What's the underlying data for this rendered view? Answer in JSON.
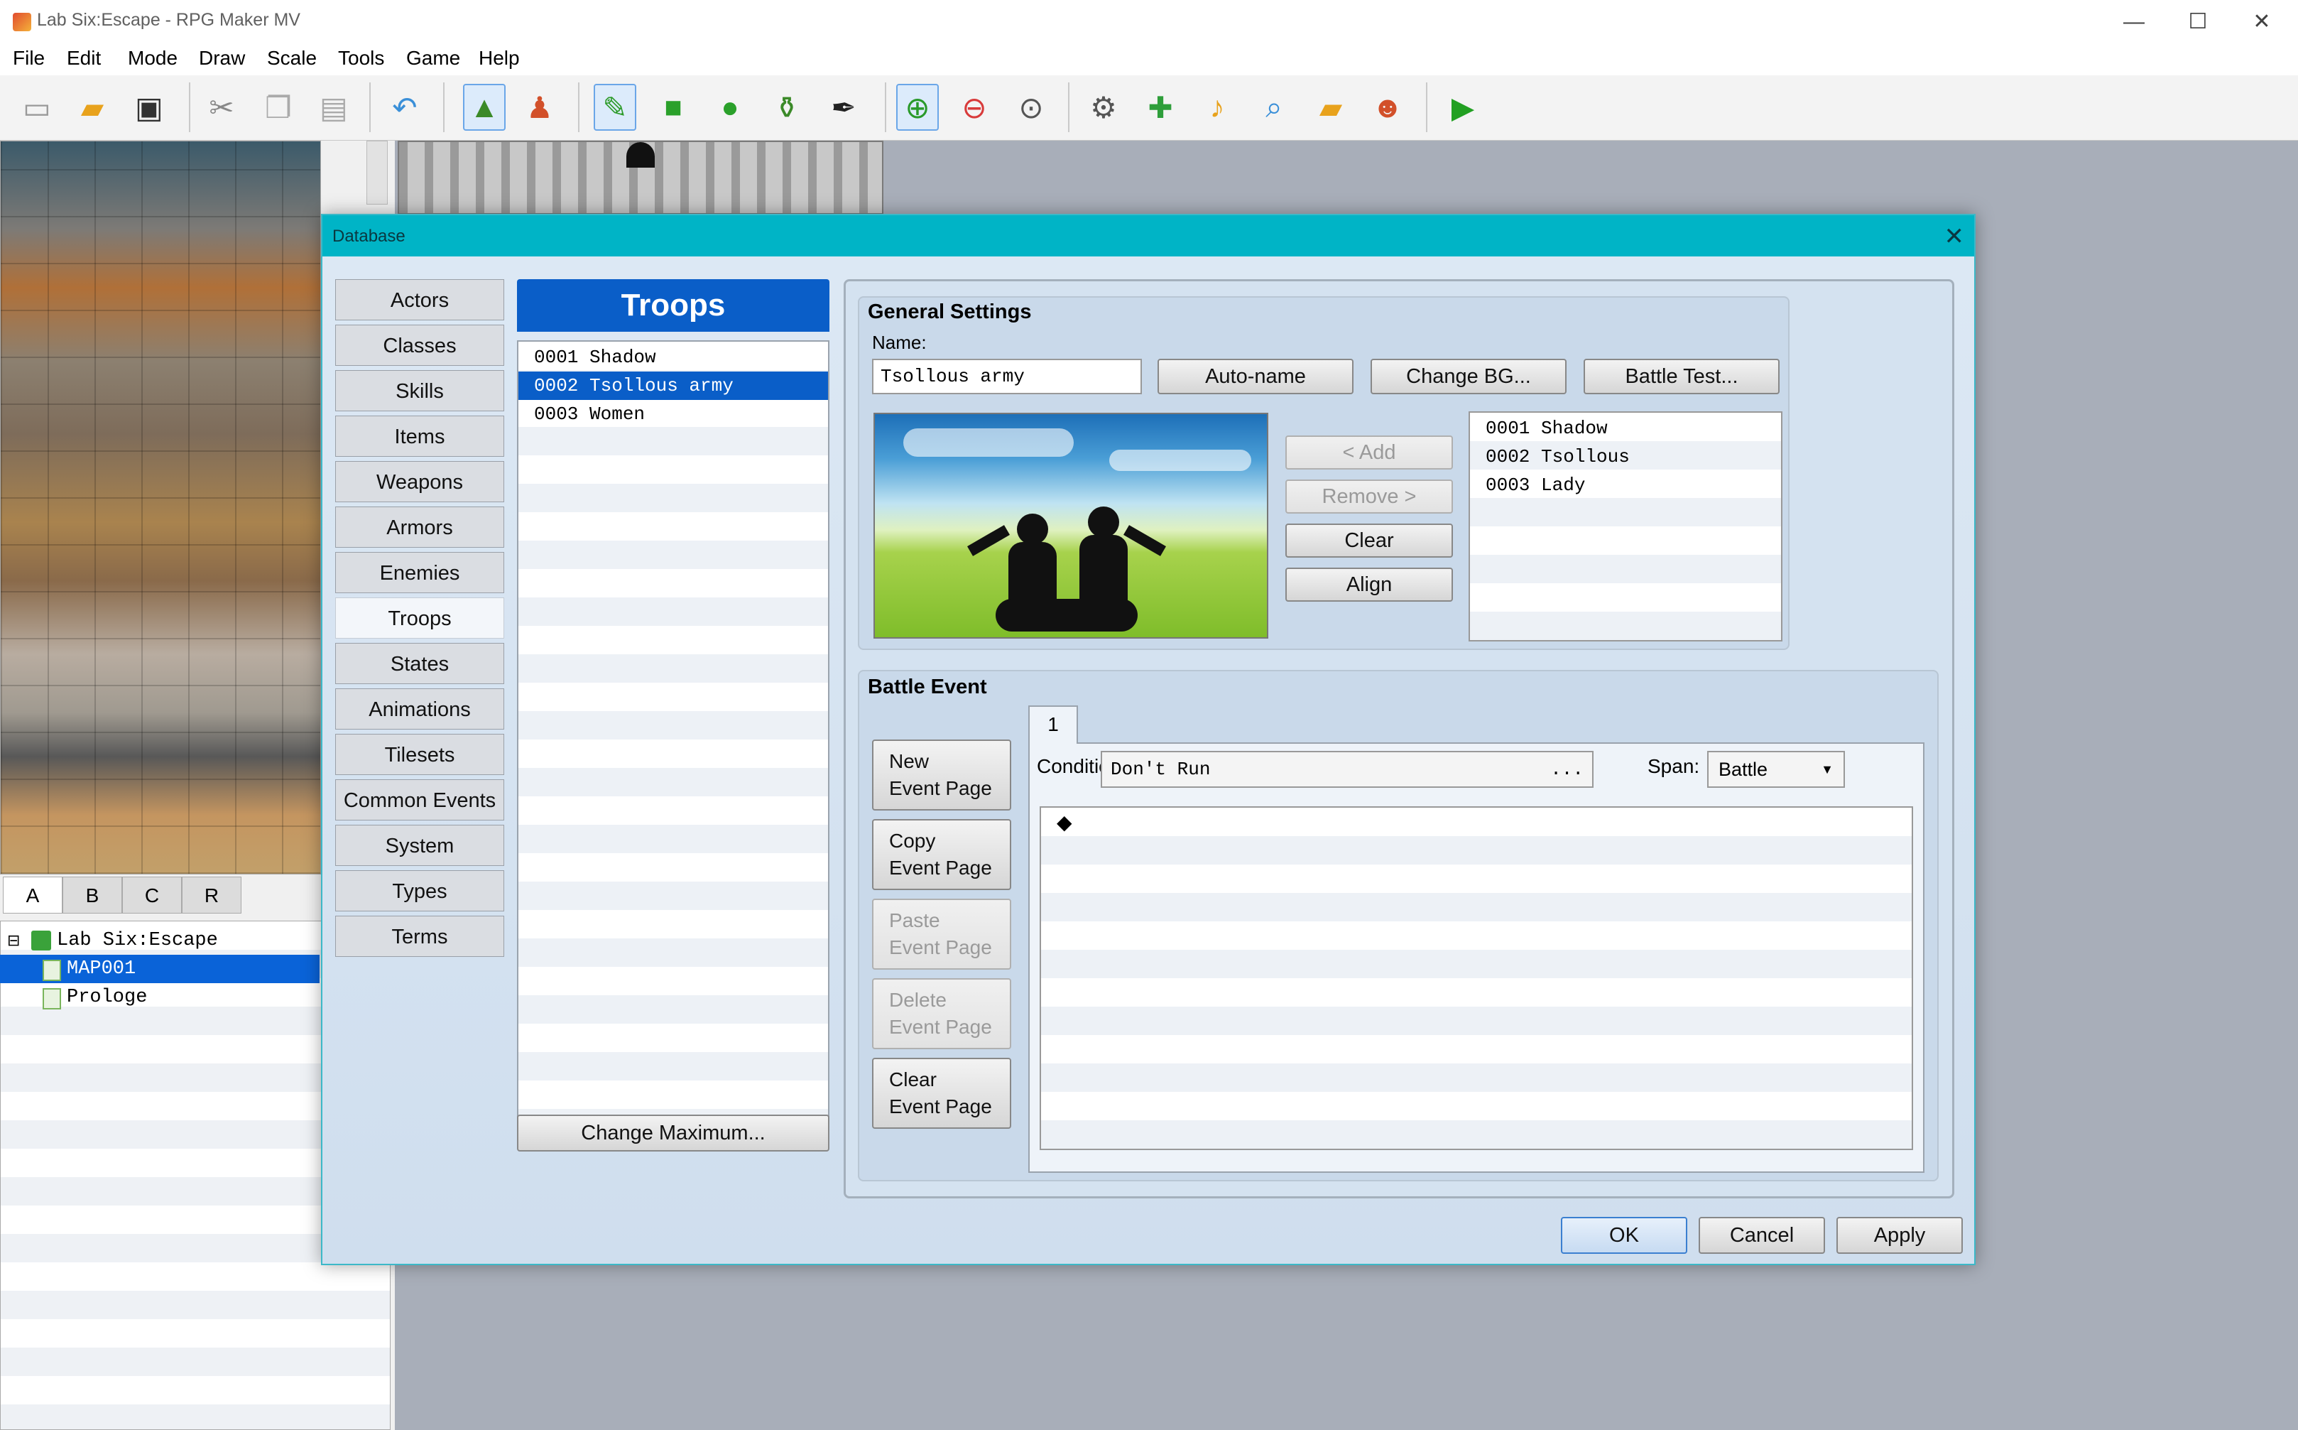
{
  "app": {
    "title": "Lab Six:Escape - RPG Maker MV",
    "window_controls": [
      "—",
      "☐",
      "✕"
    ]
  },
  "menu": [
    "File",
    "Edit",
    "Mode",
    "Draw",
    "Scale",
    "Tools",
    "Game",
    "Help"
  ],
  "toolbar": {
    "icons": [
      "new-project-icon",
      "open-project-icon",
      "save-project-icon",
      "cut-icon",
      "copy-icon",
      "paste-icon",
      "undo-icon",
      "map-mode-icon",
      "event-mode-icon",
      "pencil-icon",
      "rectangle-icon",
      "ellipse-icon",
      "flood-fill-icon",
      "shadow-pen-icon",
      "zoom-in-icon",
      "zoom-out-icon",
      "actual-size-icon",
      "database-icon",
      "plugin-manager-icon",
      "sound-test-icon",
      "event-searcher-icon",
      "resource-manager-icon",
      "character-generator-icon",
      "playtest-icon"
    ]
  },
  "tileset_tabs": [
    "A",
    "B",
    "C",
    "R"
  ],
  "map_tree": {
    "project": "Lab Six:Escape",
    "maps": [
      "MAP001",
      "Prologe"
    ],
    "selected": "MAP001"
  },
  "database": {
    "title": "Database",
    "close": "✕",
    "categories": [
      "Actors",
      "Classes",
      "Skills",
      "Items",
      "Weapons",
      "Armors",
      "Enemies",
      "Troops",
      "States",
      "Animations",
      "Tilesets",
      "Common Events",
      "System",
      "Types",
      "Terms"
    ],
    "selected_category": "Troops",
    "troops_header": "Troops",
    "troops": [
      "0001 Shadow",
      "0002 Tsollous army",
      "0003 Women"
    ],
    "selected_troop": "0002 Tsollous army",
    "change_maximum": "Change Maximum...",
    "general_settings": {
      "title": "General Settings",
      "name_label": "Name:",
      "name_value": "Tsollous army",
      "auto_name": "Auto-name",
      "change_bg": "Change BG...",
      "battle_test": "Battle Test...",
      "add": "< Add",
      "remove": "Remove >",
      "clear": "Clear",
      "align": "Align",
      "enemies": [
        "0001 Shadow",
        "0002 Tsollous",
        "0003 Lady"
      ]
    },
    "battle_event": {
      "title": "Battle Event",
      "buttons": {
        "new_page": [
          "New",
          "Event Page"
        ],
        "copy_page": [
          "Copy",
          "Event Page"
        ],
        "paste_page": [
          "Paste",
          "Event Page"
        ],
        "delete_page": [
          "Delete",
          "Event Page"
        ],
        "clear_page": [
          "Clear",
          "Event Page"
        ]
      },
      "page_tab": "1",
      "conditions_label": "Conditions:",
      "conditions_value": "Don't Run",
      "conditions_more": "...",
      "span_label": "Span:",
      "span_value": "Battle",
      "event_marker": "◆"
    },
    "footer": {
      "ok": "OK",
      "cancel": "Cancel",
      "apply": "Apply"
    }
  },
  "colors": {
    "dialog_title_bar": "#00b4c6",
    "selection": "#0a5ec8"
  }
}
